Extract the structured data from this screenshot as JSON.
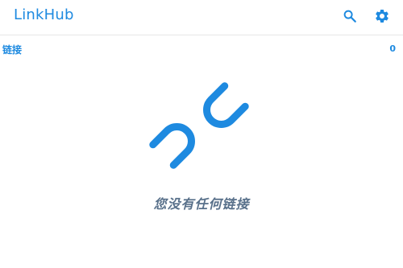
{
  "app": {
    "title": "LinkHub",
    "accent_color": "#1e8ae0"
  },
  "toolbar": {
    "search_icon": "search-icon",
    "settings_icon": "gear-icon"
  },
  "section": {
    "label": "链接",
    "count": "0"
  },
  "empty_state": {
    "icon": "broken-link-icon",
    "message": "您没有任何链接"
  }
}
